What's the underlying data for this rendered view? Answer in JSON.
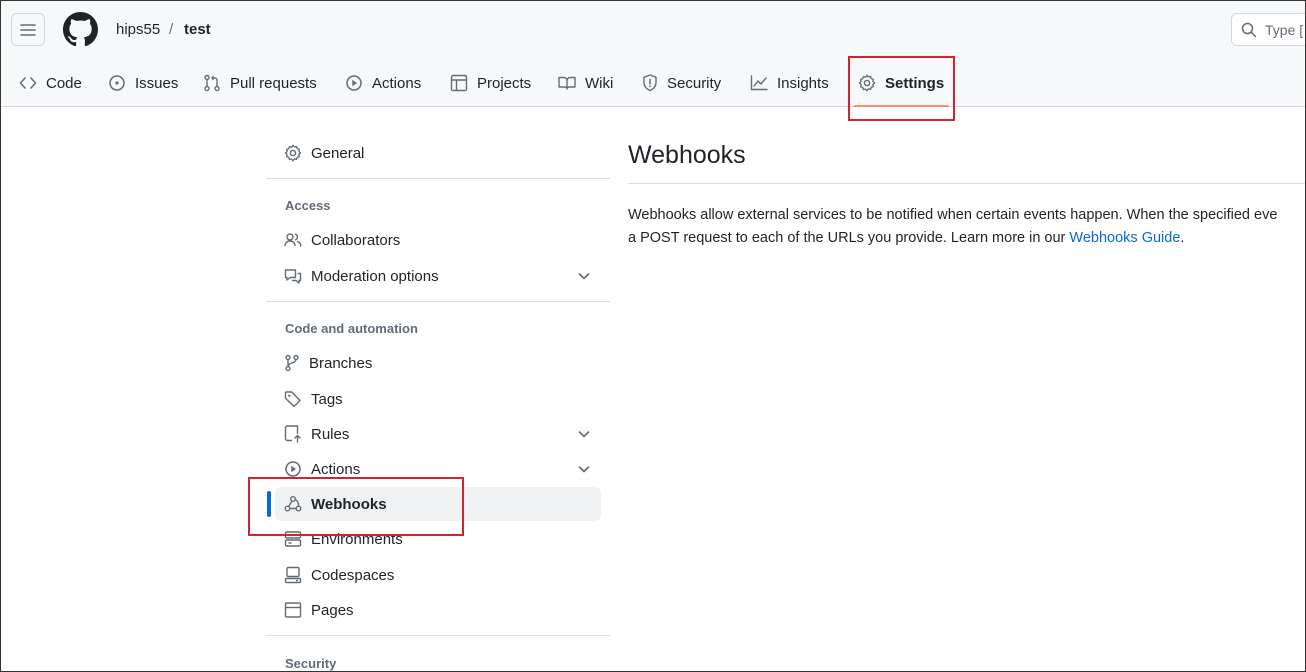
{
  "breadcrumb": {
    "owner": "hips55",
    "separator": "/",
    "repo": "test"
  },
  "search": {
    "placeholder": "Type ["
  },
  "tabs": [
    {
      "label": "Code",
      "icon": "code-icon"
    },
    {
      "label": "Issues",
      "icon": "issue-icon"
    },
    {
      "label": "Pull requests",
      "icon": "pull-request-icon"
    },
    {
      "label": "Actions",
      "icon": "play-icon"
    },
    {
      "label": "Projects",
      "icon": "table-icon"
    },
    {
      "label": "Wiki",
      "icon": "book-icon"
    },
    {
      "label": "Security",
      "icon": "shield-icon"
    },
    {
      "label": "Insights",
      "icon": "graph-icon"
    },
    {
      "label": "Settings",
      "icon": "gear-icon",
      "selected": true
    }
  ],
  "sidebar": {
    "general": "General",
    "access_heading": "Access",
    "collaborators": "Collaborators",
    "moderation": "Moderation options",
    "code_heading": "Code and automation",
    "branches": "Branches",
    "tags": "Tags",
    "rules": "Rules",
    "actions": "Actions",
    "webhooks": "Webhooks",
    "environments": "Environments",
    "codespaces": "Codespaces",
    "pages": "Pages",
    "security_heading": "Security"
  },
  "main": {
    "title": "Webhooks",
    "desc_line1": "Webhooks allow external services to be notified when certain events happen. When the specified eve",
    "desc_line2_prefix": "a POST request to each of the URLs you provide. Learn more in our ",
    "desc_link": "Webhooks Guide",
    "desc_suffix": "."
  },
  "colors": {
    "accent": "#0969da",
    "highlight": "#d1242f",
    "tab_underline": "#fd8c73"
  }
}
